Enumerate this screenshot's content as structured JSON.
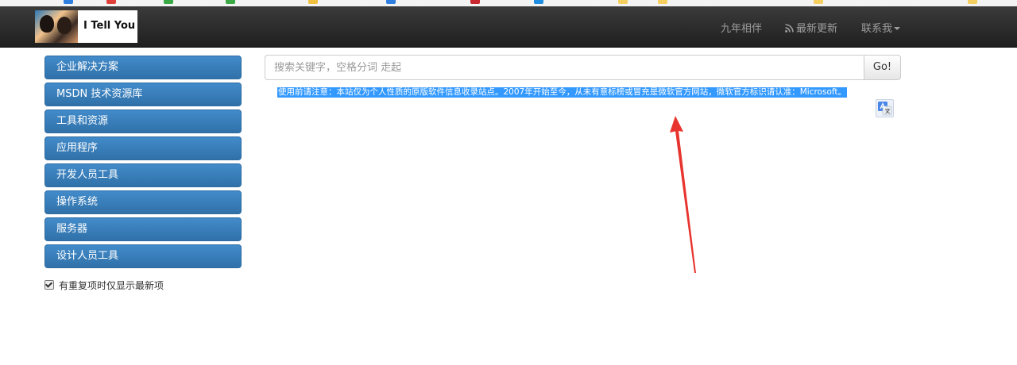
{
  "navbar": {
    "brand_text": "I Tell You",
    "links": [
      {
        "label": "九年相伴"
      },
      {
        "label": "最新更新",
        "icon": "rss-icon"
      },
      {
        "label": "联系我",
        "icon": "caret-down-icon"
      }
    ]
  },
  "sidebar": {
    "items": [
      {
        "label": "企业解决方案"
      },
      {
        "label": "MSDN 技术资源库"
      },
      {
        "label": "工具和资源"
      },
      {
        "label": "应用程序"
      },
      {
        "label": "开发人员工具"
      },
      {
        "label": "操作系统"
      },
      {
        "label": "服务器"
      },
      {
        "label": "设计人员工具"
      }
    ],
    "checkbox": {
      "label": "有重复项时仅显示最新项",
      "checked": true
    }
  },
  "search": {
    "placeholder": "搜索关键字，空格分词 走起",
    "value": "",
    "button_label": "Go!"
  },
  "notice": {
    "text": "使用前请注意：本站仅为个人性质的原版软件信息收录站点。2007年开始至今，从未有意标榜或冒充是微软官方网站，微软官方标识请认准：Microsoft。",
    "selected": true
  },
  "colors": {
    "navbar": "#222222",
    "sidebar_button": "#428bca",
    "selection": "#3399ff",
    "arrow": "#e8342f"
  }
}
